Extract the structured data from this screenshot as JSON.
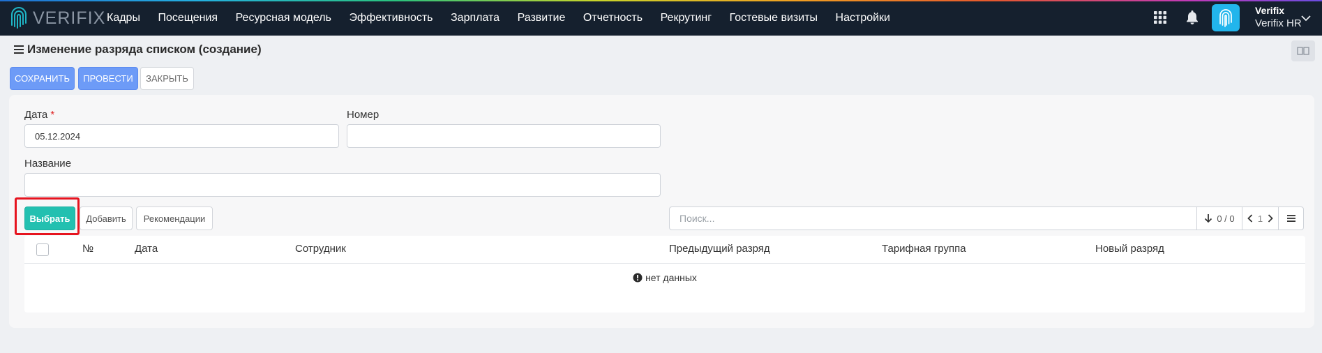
{
  "app": {
    "logo_text": "VERIFIX",
    "nav": [
      "Кадры",
      "Посещения",
      "Ресурсная модель",
      "Эффективность",
      "Зарплата",
      "Развитие",
      "Отчетность",
      "Рекрутинг",
      "Гостевые визиты",
      "Настройки"
    ],
    "user": {
      "name": "Verifix",
      "company": "Verifix HR"
    },
    "colors": {
      "topbar": "#15202e",
      "primary": "#6d9bf7",
      "teal": "#23c0b0",
      "highlight": "#e6141f"
    }
  },
  "page": {
    "title": "Изменение разряда списком (создание)",
    "actions": {
      "save": "СОХРАНИТЬ",
      "post": "ПРОВЕСТИ",
      "close": "ЗАКРЫТЬ"
    }
  },
  "form": {
    "date_label": "Дата",
    "required_mark": "*",
    "date_value": "05.12.2024",
    "number_label": "Номер",
    "number_value": "",
    "name_label": "Название",
    "name_value": ""
  },
  "list": {
    "select_btn": "Выбрать",
    "add_btn": "Добавить",
    "recommend_btn": "Рекомендации",
    "search_placeholder": "Поиск...",
    "count": "0 / 0",
    "page": "1",
    "columns": [
      "№",
      "Дата",
      "Сотрудник",
      "Предыдущий разряд",
      "Тарифная группа",
      "Новый разряд"
    ],
    "rows": [],
    "empty_text": "нет данных"
  }
}
